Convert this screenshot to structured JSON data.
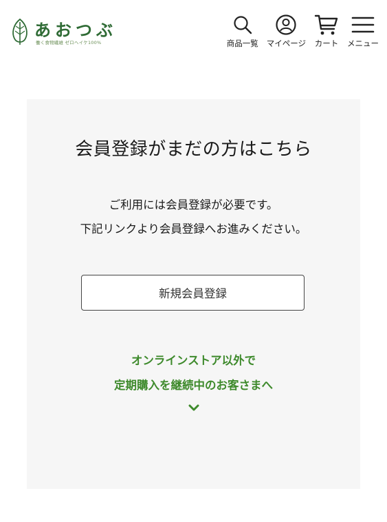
{
  "header": {
    "logo": {
      "text": "あおつぶ",
      "tagline": "働く食物繊維 ゼロヘイケ100%"
    },
    "nav": [
      {
        "label": "商品一覧",
        "icon": "search-icon"
      },
      {
        "label": "マイページ",
        "icon": "user-circle-icon"
      },
      {
        "label": "カート",
        "icon": "cart-icon"
      },
      {
        "label": "メニュー",
        "icon": "hamburger-menu-icon"
      }
    ]
  },
  "panel": {
    "title": "会員登録がまだの方はこちら",
    "description": [
      "ご利用には会員登録が必要です。",
      "下記リンクより会員登録へお進みください。"
    ],
    "register_button_label": "新規会員登録",
    "other_store_link": {
      "lines": [
        "オンラインストア以外で",
        "定期購入を継続中のお客さまへ"
      ],
      "icon": "chevron-down-icon"
    }
  },
  "colors": {
    "brand_green": "#2f6b35",
    "link_green": "#3e8a2c",
    "panel_background": "#f6f6f6",
    "button_border": "#444444"
  }
}
